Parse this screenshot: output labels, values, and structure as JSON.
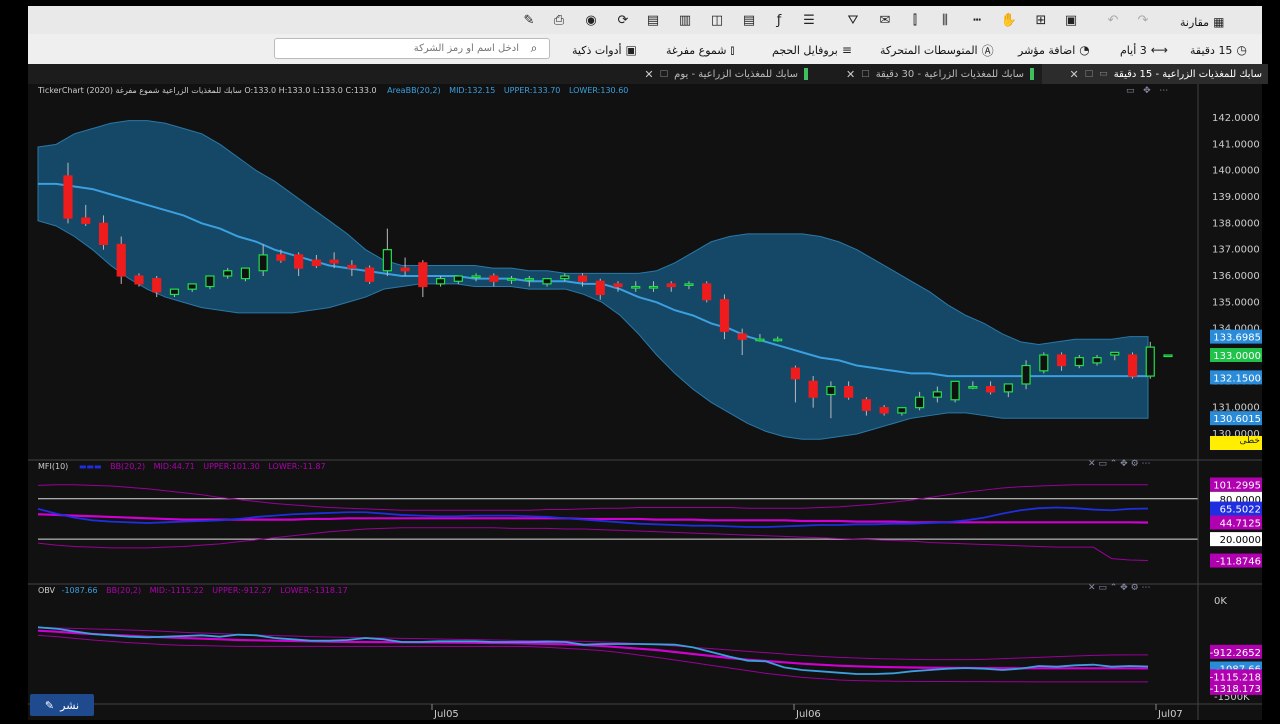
{
  "toolbar": {
    "compare_label": "مقارنة",
    "period_label": "3 أيام",
    "interval_label": "15 دقيقة",
    "add_indicator_label": "اضافة مؤشر",
    "moving_averages_label": "المتوسطات المتحركة",
    "volume_profile_label": "بروفايل الحجم",
    "hollow_candles_label": "شموع مفرغة",
    "smart_tools_label": "أدوات ذكية",
    "search_placeholder": "ادخل اسم أو رمز الشركة"
  },
  "tabs": [
    {
      "label": "سابك للمغذيات الزراعية - 15 دقيقة"
    },
    {
      "label": "سابك للمغذيات الزراعية - 30 دقيقة"
    },
    {
      "label": "سابك للمغذيات الزراعية - يوم"
    }
  ],
  "main_panel": {
    "title": "TickerChart سابك للمغذيات الزراعية شموع مفرغة (2020) O:133.0 H:133.0 L:133.0 C:133.0",
    "bb_label": "AreaBB(20,2)",
    "bb_mid": "MID:132.15",
    "bb_upper": "UPPER:133.70",
    "bb_lower": "LOWER:130.60",
    "y_ticks": [
      "142.0000",
      "141.0000",
      "140.0000",
      "139.0000",
      "138.0000",
      "137.0000",
      "136.0000",
      "135.0000",
      "134.0000",
      "133.0000",
      "132.0000",
      "131.0000",
      "130.0000"
    ],
    "badges": [
      "133.6985",
      "133.0000",
      "132.1500",
      "130.6015"
    ],
    "badge_colors": [
      "#2a8bd8",
      "#21c24a",
      "#2a8bd8",
      "#2a8bd8"
    ],
    "line_mode_label": "خطى"
  },
  "mfi_panel": {
    "title": "MFI(10)",
    "bb_label": "BB(20,2)",
    "bb_mid": "MID:44.71",
    "bb_upper": "UPPER:101.30",
    "bb_lower": "LOWER:-11.87",
    "badges": [
      "101.2995",
      "80.0000",
      "65.5022",
      "44.7125",
      "20.0000",
      "-11.8746"
    ]
  },
  "obv_panel": {
    "title": "OBV",
    "value": "-1087.66",
    "bb_label": "BB(20,2)",
    "bb_mid": "MID:-1115.22",
    "bb_upper": "UPPER:-912.27",
    "bb_lower": "LOWER:-1318.17",
    "y_ticks": [
      "0K",
      "-1500K"
    ],
    "badges": [
      "-912.2652",
      "-1087.66",
      "-1115.218",
      "-1318.173"
    ]
  },
  "x_axis": [
    "Jul05",
    "Jul06",
    "Jul07"
  ],
  "share_label": "نشر",
  "colors": {
    "up": "#21e04a",
    "down": "#ee1c1c",
    "band": "#154766",
    "bb_line": "#3aa0e0",
    "mfi": "#1f2fe0",
    "bb_magenta": "#c000c0"
  },
  "chart_data": {
    "type": "candlestick",
    "interval": "15 دقيقة",
    "ylim": [
      130,
      142
    ],
    "candles": [
      {
        "o": 139.8,
        "h": 140.3,
        "c": 138.2,
        "l": 138.0
      },
      {
        "o": 138.2,
        "h": 138.7,
        "c": 138.0,
        "l": 137.9
      },
      {
        "o": 138.0,
        "h": 138.3,
        "c": 137.2,
        "l": 137.0
      },
      {
        "o": 137.2,
        "h": 137.5,
        "c": 136.0,
        "l": 135.7
      },
      {
        "o": 136.0,
        "h": 136.1,
        "c": 135.7,
        "l": 135.6
      },
      {
        "o": 135.9,
        "h": 136.0,
        "c": 135.4,
        "l": 135.2
      },
      {
        "o": 135.3,
        "h": 135.5,
        "c": 135.5,
        "l": 135.2
      },
      {
        "o": 135.5,
        "h": 135.7,
        "c": 135.7,
        "l": 135.4
      },
      {
        "o": 135.6,
        "h": 136.0,
        "c": 136.0,
        "l": 135.5
      },
      {
        "o": 136.0,
        "h": 136.3,
        "c": 136.2,
        "l": 135.9
      },
      {
        "o": 135.9,
        "h": 136.3,
        "c": 136.3,
        "l": 135.8
      },
      {
        "o": 136.2,
        "h": 137.2,
        "c": 136.8,
        "l": 136.0
      },
      {
        "o": 136.8,
        "h": 137.0,
        "c": 136.6,
        "l": 136.5
      },
      {
        "o": 136.8,
        "h": 136.9,
        "c": 136.3,
        "l": 136.0
      },
      {
        "o": 136.6,
        "h": 136.8,
        "c": 136.4,
        "l": 136.3
      },
      {
        "o": 136.6,
        "h": 136.9,
        "c": 136.5,
        "l": 136.3
      },
      {
        "o": 136.4,
        "h": 136.6,
        "c": 136.3,
        "l": 136.0
      },
      {
        "o": 136.3,
        "h": 136.4,
        "c": 135.8,
        "l": 135.7
      },
      {
        "o": 136.2,
        "h": 137.8,
        "c": 137.0,
        "l": 136.0
      },
      {
        "o": 136.3,
        "h": 136.7,
        "c": 136.2,
        "l": 136.0
      },
      {
        "o": 136.5,
        "h": 136.6,
        "c": 135.6,
        "l": 135.2
      },
      {
        "o": 135.7,
        "h": 136.0,
        "c": 135.9,
        "l": 135.6
      },
      {
        "o": 135.8,
        "h": 136.0,
        "c": 136.0,
        "l": 135.7
      },
      {
        "o": 136.0,
        "h": 136.1,
        "c": 136.0,
        "l": 135.8
      },
      {
        "o": 136.0,
        "h": 136.1,
        "c": 135.8,
        "l": 135.6
      },
      {
        "o": 135.9,
        "h": 136.0,
        "c": 135.9,
        "l": 135.7
      },
      {
        "o": 135.9,
        "h": 136.0,
        "c": 135.9,
        "l": 135.6
      },
      {
        "o": 135.7,
        "h": 135.9,
        "c": 135.9,
        "l": 135.6
      },
      {
        "o": 135.9,
        "h": 136.1,
        "c": 136.0,
        "l": 135.8
      },
      {
        "o": 136.0,
        "h": 136.1,
        "c": 135.8,
        "l": 135.6
      },
      {
        "o": 135.8,
        "h": 135.9,
        "c": 135.3,
        "l": 135.1
      },
      {
        "o": 135.7,
        "h": 135.8,
        "c": 135.6,
        "l": 135.4
      },
      {
        "o": 135.6,
        "h": 135.8,
        "c": 135.6,
        "l": 135.4
      },
      {
        "o": 135.6,
        "h": 135.8,
        "c": 135.6,
        "l": 135.4
      },
      {
        "o": 135.7,
        "h": 135.8,
        "c": 135.6,
        "l": 135.4
      },
      {
        "o": 135.7,
        "h": 135.8,
        "c": 135.7,
        "l": 135.5
      },
      {
        "o": 135.7,
        "h": 135.8,
        "c": 135.1,
        "l": 135.0
      },
      {
        "o": 135.1,
        "h": 135.3,
        "c": 133.9,
        "l": 133.6
      },
      {
        "o": 133.8,
        "h": 134.0,
        "c": 133.6,
        "l": 133.0
      },
      {
        "o": 133.6,
        "h": 133.8,
        "c": 133.6,
        "l": 133.5
      },
      {
        "o": 133.6,
        "h": 133.7,
        "c": 133.6,
        "l": 133.5
      },
      {
        "o": 132.5,
        "h": 132.6,
        "c": 132.1,
        "l": 131.2
      },
      {
        "o": 132.0,
        "h": 132.2,
        "c": 131.4,
        "l": 131.0
      },
      {
        "o": 131.5,
        "h": 132.0,
        "c": 131.8,
        "l": 130.6
      },
      {
        "o": 131.8,
        "h": 132.0,
        "c": 131.4,
        "l": 131.3
      },
      {
        "o": 131.3,
        "h": 131.4,
        "c": 130.9,
        "l": 130.7
      },
      {
        "o": 131.0,
        "h": 131.1,
        "c": 130.8,
        "l": 130.7
      },
      {
        "o": 130.8,
        "h": 131.0,
        "c": 131.0,
        "l": 130.7
      },
      {
        "o": 131.0,
        "h": 131.6,
        "c": 131.4,
        "l": 130.9
      },
      {
        "o": 131.4,
        "h": 131.8,
        "c": 131.6,
        "l": 131.2
      },
      {
        "o": 131.3,
        "h": 132.0,
        "c": 132.0,
        "l": 131.2
      },
      {
        "o": 131.8,
        "h": 132.0,
        "c": 131.8,
        "l": 131.7
      },
      {
        "o": 131.8,
        "h": 132.0,
        "c": 131.6,
        "l": 131.5
      },
      {
        "o": 131.6,
        "h": 131.9,
        "c": 131.9,
        "l": 131.4
      },
      {
        "o": 131.9,
        "h": 132.8,
        "c": 132.6,
        "l": 131.7
      },
      {
        "o": 132.4,
        "h": 133.1,
        "c": 133.0,
        "l": 132.3
      },
      {
        "o": 133.0,
        "h": 133.1,
        "c": 132.6,
        "l": 132.4
      },
      {
        "o": 132.6,
        "h": 133.0,
        "c": 132.9,
        "l": 132.5
      },
      {
        "o": 132.7,
        "h": 133.0,
        "c": 132.9,
        "l": 132.6
      },
      {
        "o": 133.0,
        "h": 133.1,
        "c": 133.1,
        "l": 132.8
      },
      {
        "o": 133.0,
        "h": 133.1,
        "c": 132.2,
        "l": 132.1
      },
      {
        "o": 132.2,
        "h": 133.5,
        "c": 133.3,
        "l": 132.1
      },
      {
        "o": 133.0,
        "h": 133.0,
        "c": 133.0,
        "l": 133.0
      }
    ],
    "bb_upper": [
      140.9,
      141.0,
      141.4,
      141.6,
      141.8,
      141.9,
      141.9,
      141.8,
      141.6,
      141.4,
      141.0,
      140.5,
      140.0,
      139.6,
      139.1,
      138.6,
      138.1,
      137.6,
      137.0,
      136.6,
      136.4,
      136.4,
      136.4,
      136.4,
      136.4,
      136.3,
      136.3,
      136.2,
      136.2,
      136.1,
      136.1,
      136.1,
      136.1,
      136.1,
      136.2,
      136.5,
      136.9,
      137.3,
      137.5,
      137.6,
      137.6,
      137.6,
      137.6,
      137.5,
      137.3,
      137.0,
      136.6,
      136.2,
      135.8,
      135.4,
      134.9,
      134.5,
      134.2,
      133.8,
      133.5,
      133.4,
      133.5,
      133.6,
      133.6,
      133.6,
      133.7,
      133.7
    ],
    "bb_mid": [
      139.5,
      139.5,
      139.4,
      139.3,
      139.1,
      138.9,
      138.7,
      138.5,
      138.3,
      138.0,
      137.8,
      137.5,
      137.3,
      137.0,
      136.8,
      136.6,
      136.4,
      136.3,
      136.2,
      136.1,
      136.0,
      136.0,
      136.0,
      136.0,
      135.9,
      135.9,
      135.9,
      135.8,
      135.8,
      135.8,
      135.7,
      135.7,
      135.5,
      135.2,
      135.0,
      134.7,
      134.5,
      134.2,
      134.0,
      133.7,
      133.5,
      133.3,
      133.1,
      132.9,
      132.8,
      132.6,
      132.5,
      132.4,
      132.3,
      132.3,
      132.2,
      132.2,
      132.2,
      132.2,
      132.2,
      132.2,
      132.2,
      132.2,
      132.2,
      132.2,
      132.2,
      132.2
    ],
    "bb_lower": [
      138.1,
      137.9,
      137.5,
      137.0,
      136.4,
      135.9,
      135.5,
      135.2,
      135.0,
      134.8,
      134.7,
      134.6,
      134.6,
      134.6,
      134.6,
      134.7,
      134.8,
      135.0,
      135.2,
      135.5,
      135.6,
      135.7,
      135.7,
      135.7,
      135.6,
      135.6,
      135.6,
      135.5,
      135.5,
      135.5,
      135.3,
      135.0,
      134.5,
      133.8,
      133.0,
      132.3,
      131.7,
      131.2,
      130.8,
      130.4,
      130.1,
      129.9,
      129.8,
      129.8,
      129.9,
      130.0,
      130.2,
      130.4,
      130.6,
      130.7,
      130.8,
      130.8,
      130.7,
      130.6,
      130.6,
      130.6,
      130.6,
      130.6,
      130.6,
      130.6,
      130.6,
      130.6
    ],
    "mfi": [
      65,
      58,
      52,
      48,
      46,
      45,
      44,
      45,
      46,
      47,
      48,
      50,
      53,
      55,
      57,
      58,
      59,
      60,
      60,
      58,
      56,
      55,
      54,
      54,
      55,
      55,
      55,
      54,
      53,
      51,
      49,
      47,
      45,
      43,
      42,
      41,
      40,
      40,
      39,
      38,
      38,
      39,
      40,
      41,
      41,
      42,
      42,
      43,
      43,
      44,
      45,
      48,
      52,
      58,
      63,
      66,
      67,
      66,
      64,
      63,
      65,
      65.5
    ],
    "mfi_bb_upper": [
      100,
      101,
      101,
      100,
      99,
      97,
      95,
      92,
      89,
      86,
      82,
      79,
      76,
      73,
      71,
      69,
      67,
      66,
      65,
      64,
      63,
      63,
      63,
      63,
      63,
      63,
      63,
      63,
      64,
      64,
      65,
      66,
      66,
      67,
      67,
      67,
      67,
      67,
      67,
      66,
      66,
      66,
      66,
      67,
      68,
      70,
      72,
      75,
      78,
      82,
      86,
      90,
      93,
      96,
      98,
      99,
      100,
      101,
      101,
      101,
      101,
      101
    ],
    "mfi_bb_mid": [
      57,
      56,
      55,
      54,
      53,
      52,
      51,
      50,
      49,
      49,
      49,
      49,
      49,
      49,
      49,
      50,
      50,
      51,
      51,
      51,
      51,
      51,
      51,
      51,
      51,
      51,
      51,
      51,
      51,
      51,
      50,
      50,
      50,
      50,
      49,
      49,
      49,
      48,
      48,
      48,
      48,
      48,
      47,
      47,
      47,
      46,
      46,
      46,
      45,
      45,
      45,
      45,
      45,
      45,
      45,
      45,
      45,
      45,
      45,
      45,
      45,
      44.7
    ],
    "mfi_bb_lower": [
      14,
      11,
      9,
      8,
      7,
      7,
      7,
      8,
      9,
      11,
      13,
      16,
      19,
      22,
      25,
      28,
      31,
      33,
      35,
      36,
      37,
      37,
      37,
      37,
      37,
      37,
      36,
      36,
      36,
      35,
      35,
      34,
      33,
      32,
      31,
      30,
      29,
      28,
      27,
      26,
      25,
      24,
      23,
      22,
      21,
      20,
      19,
      18,
      17,
      15,
      14,
      13,
      12,
      11,
      10,
      9,
      8,
      8,
      8,
      -9,
      -11,
      -11.9
    ],
    "mfi_levels": [
      80,
      20
    ],
    "obv": [
      -500,
      -520,
      -560,
      -600,
      -620,
      -640,
      -650,
      -640,
      -630,
      -620,
      -640,
      -610,
      -620,
      -660,
      -680,
      -700,
      -700,
      -690,
      -660,
      -680,
      -720,
      -720,
      -710,
      -710,
      -710,
      -720,
      -720,
      -720,
      -715,
      -720,
      -760,
      -750,
      -750,
      -750,
      -755,
      -760,
      -800,
      -870,
      -940,
      -1000,
      -1010,
      -1100,
      -1140,
      -1160,
      -1180,
      -1200,
      -1200,
      -1190,
      -1160,
      -1140,
      -1120,
      -1110,
      -1120,
      -1140,
      -1120,
      -1080,
      -1090,
      -1070,
      -1060,
      -1090,
      -1080,
      -1087.66
    ],
    "obv_bb_upper": [
      -500,
      -510,
      -515,
      -525,
      -530,
      -540,
      -550,
      -560,
      -575,
      -585,
      -595,
      -605,
      -615,
      -625,
      -630,
      -640,
      -645,
      -650,
      -655,
      -660,
      -665,
      -670,
      -675,
      -680,
      -685,
      -690,
      -695,
      -700,
      -700,
      -705,
      -710,
      -720,
      -730,
      -745,
      -760,
      -780,
      -800,
      -820,
      -840,
      -860,
      -880,
      -900,
      -920,
      -935,
      -950,
      -960,
      -970,
      -975,
      -980,
      -985,
      -985,
      -985,
      -980,
      -970,
      -960,
      -950,
      -940,
      -930,
      -920,
      -915,
      -913,
      -912.27
    ],
    "obv_bb_mid": [
      -550,
      -565,
      -585,
      -600,
      -615,
      -625,
      -640,
      -650,
      -660,
      -670,
      -680,
      -690,
      -695,
      -700,
      -705,
      -710,
      -715,
      -718,
      -720,
      -722,
      -724,
      -726,
      -728,
      -730,
      -732,
      -735,
      -738,
      -742,
      -748,
      -755,
      -765,
      -780,
      -800,
      -820,
      -840,
      -870,
      -900,
      -930,
      -960,
      -985,
      -1005,
      -1025,
      -1045,
      -1060,
      -1075,
      -1085,
      -1092,
      -1098,
      -1102,
      -1106,
      -1108,
      -1110,
      -1112,
      -1113,
      -1114,
      -1114,
      -1115,
      -1115,
      -1115,
      -1115,
      -1115,
      -1115.22
    ],
    "obv_bb_lower": [
      -620,
      -640,
      -665,
      -690,
      -710,
      -730,
      -745,
      -760,
      -770,
      -775,
      -780,
      -785,
      -785,
      -785,
      -785,
      -785,
      -785,
      -785,
      -785,
      -785,
      -785,
      -785,
      -785,
      -785,
      -785,
      -785,
      -785,
      -790,
      -800,
      -815,
      -830,
      -850,
      -880,
      -915,
      -950,
      -990,
      -1030,
      -1070,
      -1110,
      -1150,
      -1190,
      -1220,
      -1250,
      -1270,
      -1290,
      -1300,
      -1305,
      -1308,
      -1310,
      -1312,
      -1313,
      -1314,
      -1315,
      -1316,
      -1317,
      -1318,
      -1318,
      -1318,
      -1318,
      -1318,
      -1318,
      -1318.17
    ],
    "obv_ylim": [
      -1500,
      0
    ]
  }
}
